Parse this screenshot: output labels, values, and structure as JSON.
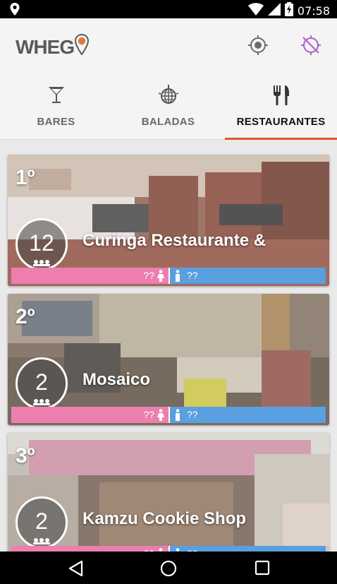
{
  "status_bar": {
    "time": "07:58"
  },
  "app": {
    "logo_text": "WHEG"
  },
  "tabs": [
    {
      "label": "BARES",
      "icon": "cocktail-icon"
    },
    {
      "label": "BALADAS",
      "icon": "disco-ball-icon"
    },
    {
      "label": "RESTAURANTES",
      "icon": "fork-knife-icon",
      "active": true
    }
  ],
  "cards": [
    {
      "rank": "1º",
      "count": "12",
      "name": "Curinga Restaurante &",
      "female_count": "??",
      "male_count": "??"
    },
    {
      "rank": "2º",
      "count": "2",
      "name": "Mosaico",
      "female_count": "??",
      "male_count": "??"
    },
    {
      "rank": "3º",
      "count": "2",
      "name": "Kamzu Cookie Shop",
      "female_count": "??",
      "male_count": "??"
    }
  ],
  "colors": {
    "accent": "#e0542b",
    "female": "#ec7fae",
    "male": "#5a9fe0",
    "logo_pin": "#e07a3a",
    "gps_off": "#b05ec8"
  }
}
